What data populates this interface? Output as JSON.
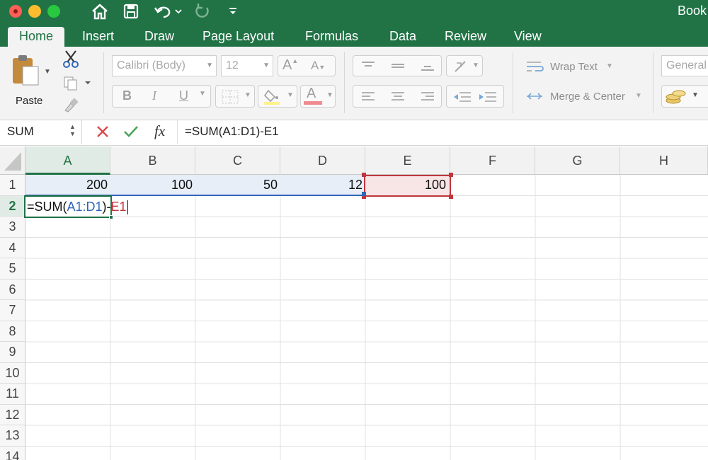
{
  "window": {
    "title": "Book",
    "colors": {
      "accent": "#217346",
      "range_blue": "#2f67b8",
      "range_red": "#c0363d"
    }
  },
  "quick_access": {
    "icons": [
      "home-icon",
      "save-icon",
      "undo-icon",
      "redo-icon",
      "customize-toolbar-icon"
    ]
  },
  "tabs": [
    {
      "label": "Home",
      "active": true
    },
    {
      "label": "Insert"
    },
    {
      "label": "Draw"
    },
    {
      "label": "Page Layout"
    },
    {
      "label": "Formulas"
    },
    {
      "label": "Data"
    },
    {
      "label": "Review"
    },
    {
      "label": "View"
    }
  ],
  "ribbon": {
    "paste_label": "Paste",
    "font_name": "Calibri (Body)",
    "font_size": "12",
    "bold": "B",
    "italic": "I",
    "underline": "U",
    "wrap_text": "Wrap Text",
    "merge_center": "Merge & Center",
    "number_format": "General",
    "font_color": "A",
    "increase_font": "A",
    "decrease_font": "A"
  },
  "formula_bar": {
    "name_box": "SUM",
    "fx": "fx",
    "formula": "=SUM(A1:D1)-E1"
  },
  "sheet": {
    "columns": [
      "A",
      "B",
      "C",
      "D",
      "E",
      "F",
      "G",
      "H"
    ],
    "rows": [
      "1",
      "2",
      "3",
      "4",
      "5",
      "6",
      "7",
      "8",
      "9",
      "10",
      "11",
      "12",
      "13",
      "14"
    ],
    "cells": {
      "A1": "200",
      "B1": "100",
      "C1": "50",
      "D1": "12",
      "E1": "100"
    },
    "edit_cell": {
      "address": "A2",
      "prefix": "=SUM(",
      "range_ref": "A1:D1",
      "mid": ")-",
      "cell_ref": "E1"
    }
  }
}
